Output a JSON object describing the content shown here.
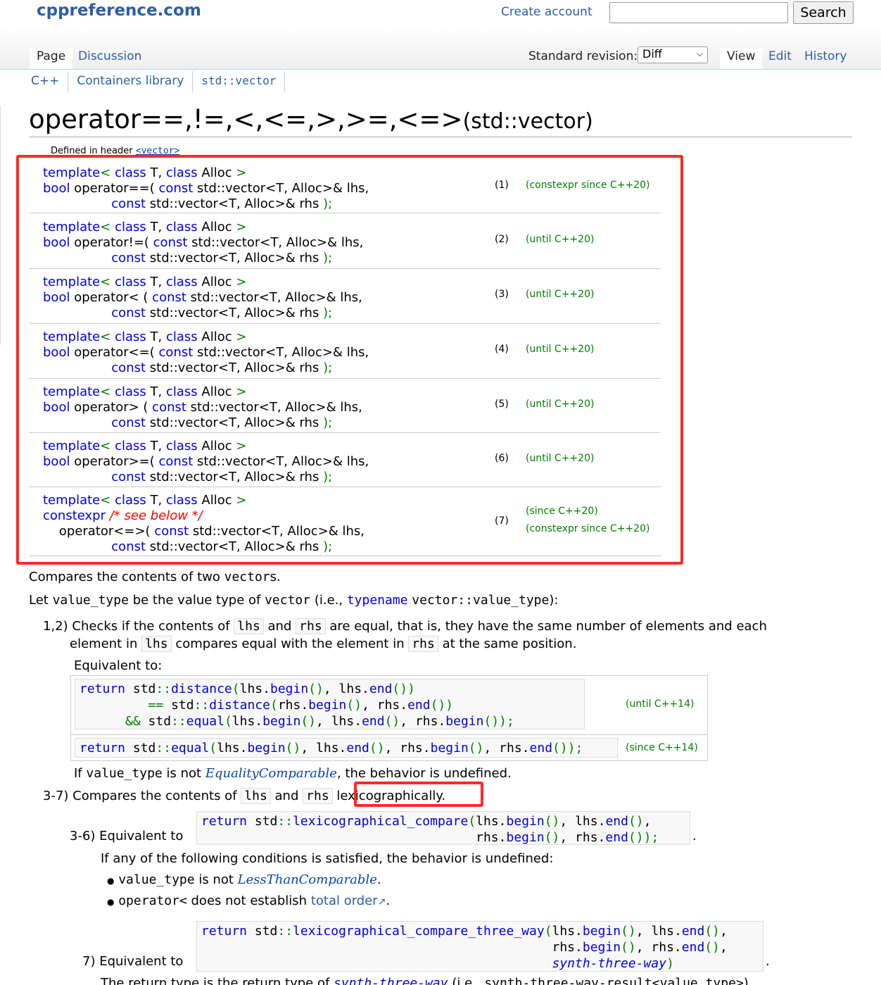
{
  "site": {
    "logo": "cppreference.com",
    "create_account": "Create account",
    "search_placeholder": "",
    "search_button": "Search"
  },
  "tabs": {
    "page": "Page",
    "discussion": "Discussion",
    "revision_label": "Standard revision:",
    "revision_value": "Diff",
    "view": "View",
    "edit": "Edit",
    "history": "History"
  },
  "breadcrumbs": [
    "C++",
    "Containers library",
    "std::vector"
  ],
  "title": {
    "main": "operator==,!=,<,<=,>,>=,<=>",
    "suffix": "(std::vector)"
  },
  "defined_in": {
    "label": "Defined in header",
    "header": "<vector>"
  },
  "declarations": [
    {
      "op": "operator==(",
      "num": "(1)",
      "ver": [
        "(constexpr since C++20)"
      ]
    },
    {
      "op": "operator!=(",
      "num": "(2)",
      "ver": [
        "(until C++20)"
      ]
    },
    {
      "op": "operator< (",
      "num": "(3)",
      "ver": [
        "(until C++20)"
      ]
    },
    {
      "op": "operator<=(",
      "num": "(4)",
      "ver": [
        "(until C++20)"
      ]
    },
    {
      "op": "operator> (",
      "num": "(5)",
      "ver": [
        "(until C++20)"
      ]
    },
    {
      "op": "operator>=(",
      "num": "(6)",
      "ver": [
        "(until C++20)"
      ]
    },
    {
      "op": "operator<=>(",
      "num": "(7)",
      "ver": [
        "(since C++20)",
        "(constexpr since C++20)"
      ]
    }
  ],
  "decl_parts": {
    "template": "template",
    "class": "class",
    "T": "T",
    "Alloc": "Alloc",
    "bool": "bool",
    "const": "const",
    "vec_type": "std::vector<T, Alloc>&",
    "lhs": "lhs",
    "rhs": "rhs",
    "constexpr": "constexpr",
    "see_below": "/* see below */"
  },
  "body": {
    "compares": "Compares the contents of two",
    "vectors": "vector",
    "s": "s.",
    "let1": "Let",
    "value_type": "value_type",
    "let2": "be the value type of",
    "vector": "vector",
    "let3": "(i.e.,",
    "typename": "typename",
    "vector_vt": "vector::value_type",
    "let4": "):",
    "item12_label": "1,2)",
    "item12_a": "Checks if the contents of",
    "lhs": "lhs",
    "and": "and",
    "rhs": "rhs",
    "item12_b": "are equal, that is, they have the same number of elements and each",
    "item12_c": "element in",
    "item12_d": "compares equal with the element in",
    "item12_e": "at the same position.",
    "equivalent_to": "Equivalent to:",
    "until14": "(until C++14)",
    "since14": "(since C++14)",
    "if_vt": "If",
    "if_not": "is not",
    "equality_comparable": "EqualityComparable",
    "undefined": ", the behavior is undefined.",
    "item37_label": "3-7)",
    "item37_a": "Compares the contents of",
    "lexicographically": "lexicographically.",
    "item36_label": "3-6)",
    "equivalent_to2": "Equivalent to",
    "period": ".",
    "if_any": "If any of the following conditions is satisfied, the behavior is undefined:",
    "less_than_comparable": "LessThanComparable",
    "operator_lt": "operator<",
    "does_not": "does not establish",
    "total_order": "total order",
    "item7_label": "7)",
    "return_type": "The return type is the return type of",
    "synth": "synth-three-way",
    "ie": "(i.e.,",
    "synth_result": "synth-three-way-result<value_type>",
    "close": ")."
  },
  "colors": {
    "link": "#2e5ea6",
    "keyword": "#0000dd",
    "version": "#008000",
    "highlight_box": "#ff2a2a"
  }
}
